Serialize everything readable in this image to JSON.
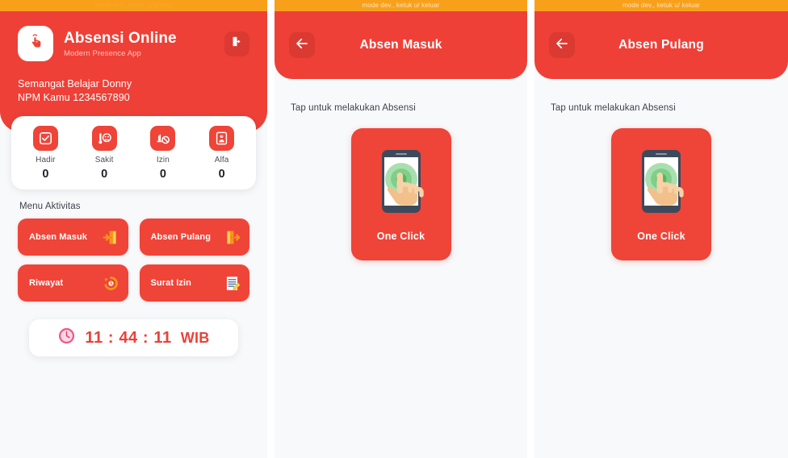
{
  "dev_banner": {
    "text": "mode dev., ketuk u/ keluar"
  },
  "screen_home": {
    "brand": {
      "title": "Absensi Online",
      "subtitle": "Modern Presence App",
      "logo_icon": "tap-hand-icon",
      "logout_icon": "logout-icon"
    },
    "greeting_line1": "Semangat Belajar Donny",
    "greeting_line2": "NPM Kamu 1234567890",
    "stats": [
      {
        "label": "Hadir",
        "value": "0",
        "icon": "checkbox-checked-icon"
      },
      {
        "label": "Sakit",
        "value": "0",
        "icon": "sick-thermometer-icon"
      },
      {
        "label": "Izin",
        "value": "0",
        "icon": "no-entry-icon"
      },
      {
        "label": "Alfa",
        "value": "0",
        "icon": "person-question-icon"
      }
    ],
    "menu_title": "Menu Aktivitas",
    "menu": [
      {
        "label": "Absen Masuk",
        "icon": "door-enter-icon"
      },
      {
        "label": "Absen Pulang",
        "icon": "door-exit-icon"
      },
      {
        "label": "Riwayat",
        "icon": "history-clock-icon"
      },
      {
        "label": "Surat Izin",
        "icon": "memo-document-icon"
      }
    ],
    "clock": {
      "icon": "clock-face-icon",
      "time": "11 : 44 : 11",
      "zone": "WIB"
    }
  },
  "screen_checkin": {
    "back_icon": "arrow-left-icon",
    "title": "Absen Masuk",
    "hint": "Tap untuk melakukan Absensi",
    "action": {
      "label": "One Click",
      "icon": "phone-tap-icon"
    }
  },
  "screen_checkout": {
    "back_icon": "arrow-left-icon",
    "title": "Absen Pulang",
    "hint": "Tap untuk melakukan Absensi",
    "action": {
      "label": "One Click",
      "icon": "phone-tap-icon"
    }
  },
  "colors": {
    "primary_red": "#ee4037",
    "button_red": "#ef4438",
    "dark_red": "#da3a31",
    "dev_orange": "#f9a01b",
    "page_bg": "#f8f9fb",
    "clock_text": "#e8423a"
  }
}
